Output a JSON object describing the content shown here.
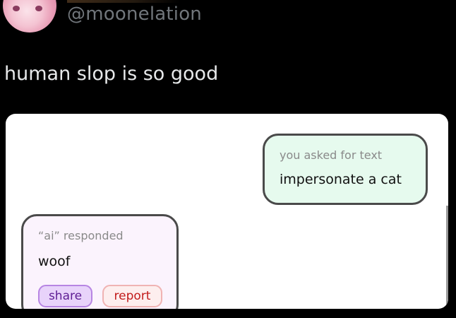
{
  "author": {
    "handle": "@moonelation"
  },
  "tweet": {
    "text": "human slop is so good"
  },
  "card": {
    "user_bubble": {
      "caption": "you asked for text",
      "body": "impersonate a cat"
    },
    "ai_bubble": {
      "caption": "“ai” responded",
      "body": "woof",
      "share_label": "share",
      "report_label": "report"
    }
  },
  "colors": {
    "background": "#000000",
    "handle": "#71767b",
    "tweet_text": "#e7e9ea",
    "user_bubble": "#e6faee",
    "ai_bubble": "#fbf3fd",
    "share": "#e8d3fa",
    "report": "#fdeeee"
  },
  "icons": {
    "avatar": "anime-avatar"
  }
}
